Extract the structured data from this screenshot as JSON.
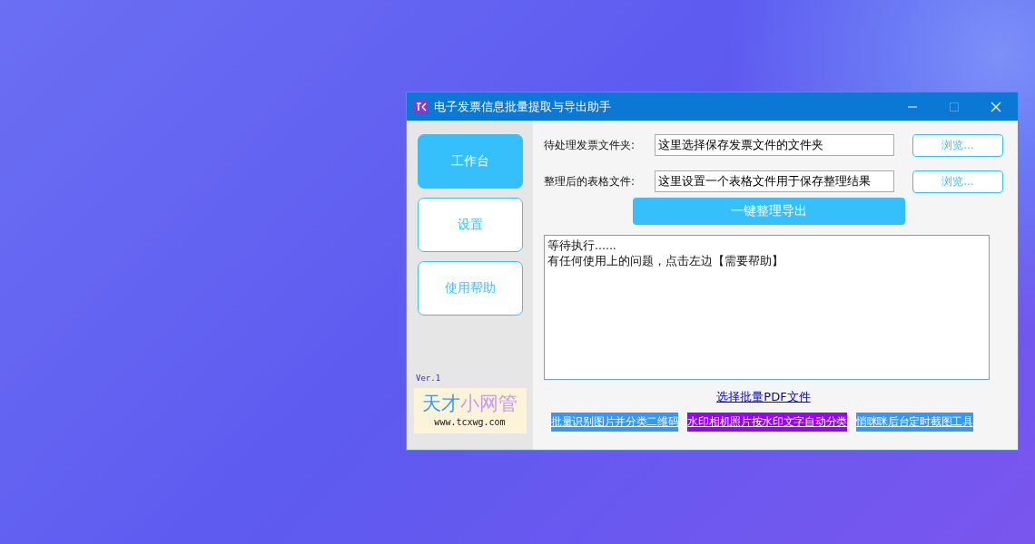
{
  "window": {
    "title": "电子发票信息批量提取与导出助手"
  },
  "nav": [
    {
      "label": "工作台",
      "selected": true
    },
    {
      "label": "设置",
      "selected": false
    },
    {
      "label": "使用帮助",
      "selected": false
    }
  ],
  "version": "Ver.1",
  "logo": {
    "part_1": "天才",
    "part_2": "小网管",
    "url": "www.tcxwg.com"
  },
  "fields": [
    {
      "label": "待处理发票文件夹:",
      "value": "这里选择保存发票文件的文件夹",
      "button": "浏览..."
    },
    {
      "label": "整理后的表格文件:",
      "value": "这里设置一个表格文件用于保存整理结果",
      "button": "浏览..."
    }
  ],
  "export_button": "一键整理导出",
  "log": [
    "等待执行......",
    "有任何使用上的问题，点击左边【需要帮助】"
  ],
  "pdf_link": "选择批量PDF文件",
  "tool_links": [
    {
      "label": "批量识别图片并分类二维码",
      "color": "#3399ff"
    },
    {
      "label": "水印相机照片按水印文字自动分类",
      "color": "#9900ff"
    },
    {
      "label": "悄咪咪后台定时截图工具",
      "color": "#3399ff"
    }
  ]
}
